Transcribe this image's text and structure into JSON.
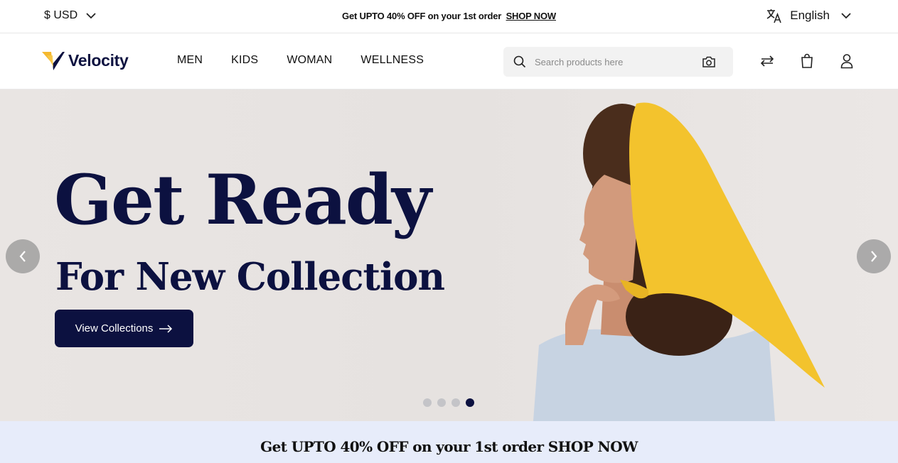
{
  "topbar": {
    "currency": "$ USD",
    "promo_text": "Get UPTO 40% OFF on your 1st order",
    "promo_link": "SHOP NOW",
    "language": "English"
  },
  "header": {
    "brand": "Velocity",
    "nav": [
      "MEN",
      "KIDS",
      "WOMAN",
      "WELLNESS"
    ],
    "search_placeholder": "Search products here"
  },
  "hero": {
    "headline": "Get Ready",
    "subheadline": "For New Collection",
    "cta_label": "View Collections",
    "slides_total": 4,
    "active_slide": 4
  },
  "strip": {
    "text": "Get UPTO 40% OFF on your 1st order SHOP NOW"
  },
  "colors": {
    "brand_navy": "#0c1140",
    "accent_yellow": "#f5b82e",
    "strip_bg": "#e7ecfa"
  }
}
